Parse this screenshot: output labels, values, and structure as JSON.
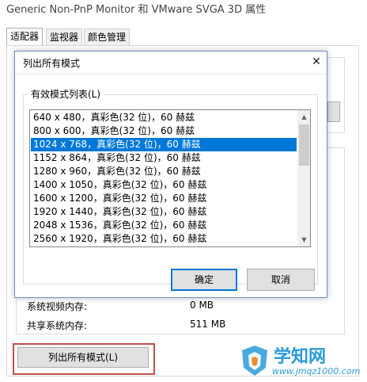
{
  "window": {
    "title": "Generic Non-PnP Monitor 和 VMware SVGA 3D 属性",
    "tabs": [
      "适配器",
      "监视器",
      "颜色管理"
    ]
  },
  "background": {
    "info_rows": [
      {
        "label": "系统视频内存:",
        "value": "0 MB"
      },
      {
        "label": "共享系统内存:",
        "value": "511 MB"
      }
    ],
    "list_all_modes_button": "列出所有模式(L)"
  },
  "dialog": {
    "title": "列出所有模式",
    "group_label": "有效模式列表(L)",
    "modes": [
      "640 x 480，真彩色(32 位)，60 赫兹",
      "800 x 600，真彩色(32 位)，60 赫兹",
      "1024 x 768，真彩色(32 位)，60 赫兹",
      "1152 x 864，真彩色(32 位)，60 赫兹",
      "1280 x 960，真彩色(32 位)，60 赫兹",
      "1400 x 1050，真彩色(32 位)，60 赫兹",
      "1600 x 1200，真彩色(32 位)，60 赫兹",
      "1920 x 1440，真彩色(32 位)，60 赫兹",
      "2048 x 1536，真彩色(32 位)，60 赫兹",
      "2560 x 1920，真彩色(32 位)，60 赫兹"
    ],
    "selected_mode": "1024 x 768，真彩色(32 位)，60 赫兹",
    "ok_button": "确定",
    "cancel_button": "取消",
    "close_icon": "close-icon"
  },
  "watermark": {
    "title": "学知网",
    "url": "www.jmqz1000.com"
  },
  "colors": {
    "selection": "#0078d7",
    "highlight_box": "#c0504d",
    "watermark": "#2a9bd8"
  }
}
